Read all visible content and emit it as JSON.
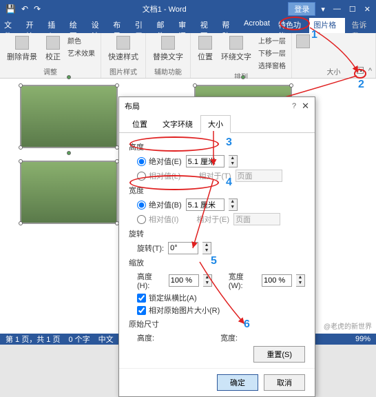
{
  "titlebar": {
    "doc": "文档1 - Word",
    "login": "登录"
  },
  "tabs": {
    "file": "文件",
    "home": "开始",
    "insert": "插入",
    "draw": "绘图",
    "design": "设计",
    "layout": "布局",
    "ref": "引用",
    "mail": "邮件",
    "review": "审阅",
    "view": "视图",
    "help": "帮助",
    "acrobat": "Acrobat",
    "special": "特色功能",
    "picfmt": "图片格式",
    "tell": "告诉我"
  },
  "ribbon": {
    "g1": {
      "removeBg": "删除背景",
      "correct": "校正",
      "color": "颜色",
      "artfx": "艺术效果",
      "label": "调整"
    },
    "g2": {
      "quick": "快速样式",
      "label": "图片样式"
    },
    "g3": {
      "alt": "替换文字",
      "label": "辅助功能"
    },
    "g4": {
      "pos": "位置",
      "wrap": "环绕文字",
      "up": "上移一层",
      "down": "下移一层",
      "sel": "选择窗格",
      "label": "排列"
    },
    "g5": {
      "label": "大小"
    }
  },
  "dialog": {
    "title": "布局",
    "tabs": {
      "pos": "位置",
      "wrap": "文字环绕",
      "size": "大小"
    },
    "height": {
      "label": "高度",
      "abs": "绝对值(E)",
      "absVal": "5.1 厘米",
      "rel": "相对值(L)",
      "relTo": "相对于(T)",
      "relVal": "页面"
    },
    "width": {
      "label": "宽度",
      "abs": "绝对值(B)",
      "absVal": "5.1 厘米",
      "rel": "相对值(I)",
      "relTo": "相对于(E)",
      "relVal": "页面"
    },
    "rotate": {
      "label": "旋转",
      "field": "旋转(T):",
      "val": "0°"
    },
    "scale": {
      "label": "缩放",
      "h": "高度(H):",
      "hVal": "100 %",
      "w": "宽度(W):",
      "wVal": "100 %",
      "lock": "锁定纵横比(A)",
      "orig": "相对原始图片大小(R)"
    },
    "origSize": {
      "label": "原始尺寸",
      "h": "高度:",
      "w": "宽度:"
    },
    "reset": "重置(S)",
    "ok": "确定",
    "cancel": "取消"
  },
  "status": {
    "page": "第 1 页，共 1 页",
    "words": "0 个字",
    "lang": "中文",
    "zoom": "99%"
  },
  "annotations": {
    "n1": "1",
    "n2": "2",
    "n3": "3",
    "n4": "4",
    "n5": "5",
    "n6": "6"
  },
  "watermark": "@老虎的新世界"
}
